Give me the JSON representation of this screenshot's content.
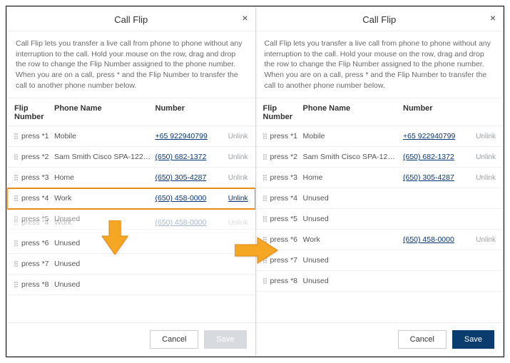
{
  "dialog": {
    "title": "Call Flip",
    "description": "Call Flip lets you transfer a live call from phone to phone without any interruption to the call. Hold your mouse on the row, drag and drop the row to change the Flip Number assigned to the phone number. When you are on a call, press * and the Flip Number to transfer the call to another phone number below.",
    "columns": {
      "flip": "Flip Number",
      "name": "Phone Name",
      "number": "Number"
    },
    "unlink_label": "Unlink",
    "cancel_label": "Cancel",
    "save_label": "Save"
  },
  "left": {
    "rows": [
      {
        "flip": "press *1",
        "name": "Mobile",
        "number": "+65 922940799",
        "unlink": true
      },
      {
        "flip": "press *2",
        "name": "Sam Smith Cisco SPA-122 A...",
        "number": "(650) 682-1372",
        "unlink": true
      },
      {
        "flip": "press *3",
        "name": "Home",
        "number": "(650) 305-4287",
        "unlink": true
      },
      {
        "flip": "press *4",
        "name": "Work",
        "number": "(650) 458-0000",
        "unlink": true,
        "selected": true
      },
      {
        "flip": "press *5",
        "name": "Unused",
        "number": "",
        "unlink": false
      },
      {
        "flip": "press *6",
        "name": "Unused",
        "number": "",
        "unlink": false,
        "ghost_over": {
          "flip": "press *4",
          "name": "Work",
          "number": "(650) 458-0000"
        }
      },
      {
        "flip": "press *7",
        "name": "Unused",
        "number": "",
        "unlink": false
      },
      {
        "flip": "press *8",
        "name": "Unused",
        "number": "",
        "unlink": false
      }
    ],
    "save_disabled": true
  },
  "right": {
    "rows": [
      {
        "flip": "press *1",
        "name": "Mobile",
        "number": "+65 922940799",
        "unlink": true
      },
      {
        "flip": "press *2",
        "name": "Sam Smith Cisco SPA-122 A...",
        "number": "(650) 682-1372",
        "unlink": true
      },
      {
        "flip": "press *3",
        "name": "Home",
        "number": "(650) 305-4287",
        "unlink": true
      },
      {
        "flip": "press *4",
        "name": "Unused",
        "number": "",
        "unlink": false
      },
      {
        "flip": "press *5",
        "name": "Unused",
        "number": "",
        "unlink": false
      },
      {
        "flip": "press *6",
        "name": "Work",
        "number": "(650) 458-0000",
        "unlink": true
      },
      {
        "flip": "press *7",
        "name": "Unused",
        "number": "",
        "unlink": false
      },
      {
        "flip": "press *8",
        "name": "Unused",
        "number": "",
        "unlink": false
      }
    ],
    "save_disabled": false
  }
}
